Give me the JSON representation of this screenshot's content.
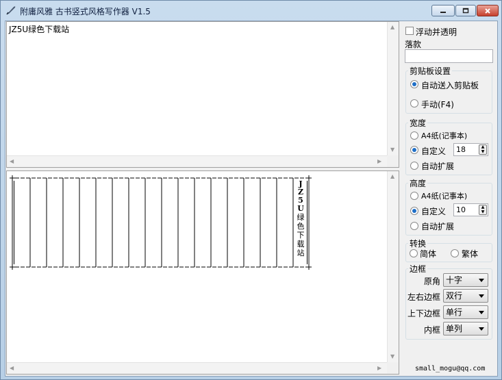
{
  "window": {
    "title": "附庸风雅 古书竖式风格写作器 V1.5"
  },
  "editor": {
    "text": "JZ5U绿色下载站"
  },
  "preview": {
    "vertical_chars": [
      "J",
      "Z",
      "5",
      "U",
      "绿",
      "色",
      "下",
      "载",
      "站"
    ]
  },
  "options": {
    "float_transparent_label": "浮动并透明",
    "signature_label": "落款",
    "signature_value": ""
  },
  "clipboard": {
    "title": "剪贴板设置",
    "auto_label": "自动送入剪贴板",
    "manual_label": "手动(F4)"
  },
  "width": {
    "title": "宽度",
    "a4_label": "A4纸(记事本)",
    "custom_label": "自定义",
    "custom_value": "18",
    "auto_label": "自动扩展"
  },
  "height": {
    "title": "高度",
    "a4_label": "A4纸(记事本)",
    "custom_label": "自定义",
    "custom_value": "10",
    "auto_label": "自动扩展"
  },
  "convert": {
    "title": "转换",
    "simplified_label": "简体",
    "traditional_label": "繁体"
  },
  "border": {
    "title": "边框",
    "corner_label": "原角",
    "corner_value": "十字",
    "lr_label": "左右边框",
    "lr_value": "双行",
    "tb_label": "上下边框",
    "tb_value": "单行",
    "inner_label": "内框",
    "inner_value": "单列"
  },
  "footer": {
    "email": "small_mogu@qq.com"
  }
}
